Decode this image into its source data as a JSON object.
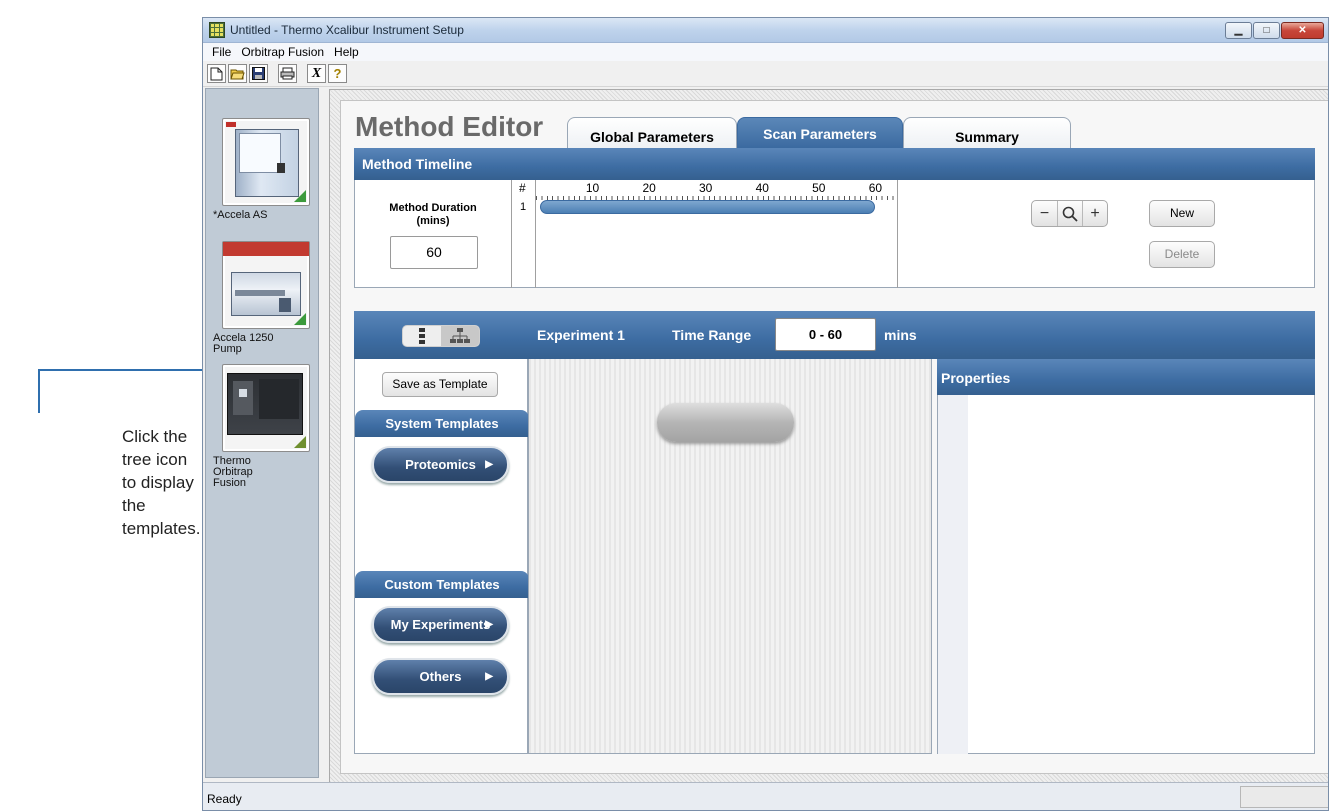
{
  "window": {
    "title": "Untitled - Thermo Xcalibur Instrument Setup"
  },
  "menu": [
    "File",
    "Orbitrap Fusion",
    "Help"
  ],
  "toolbar": {
    "new_icon": "new-document-icon",
    "open_icon": "open-folder-icon",
    "save_icon": "save-disk-icon",
    "print_icon": "printer-icon",
    "cut_icon": "x-icon",
    "help_icon": "help-question-icon"
  },
  "instruments": [
    {
      "label": "*Accela AS"
    },
    {
      "label": "Accela 1250 Pump"
    },
    {
      "label": "Thermo Orbitrap Fusion"
    }
  ],
  "editor": {
    "title": "Method Editor",
    "tabs": [
      "Global Parameters",
      "Scan Parameters",
      "Summary"
    ],
    "active_tab": "Scan Parameters"
  },
  "timeline": {
    "heading": "Method Timeline",
    "duration_label": "Method Duration (mins)",
    "duration_value": "60",
    "col_hash": "#",
    "row_number": "1",
    "ticks": [
      "10",
      "20",
      "30",
      "40",
      "50",
      "60"
    ],
    "experiment_span": [
      0,
      60
    ],
    "zoom_out": "−",
    "zoom_in": "+",
    "new_label": "New",
    "delete_label": "Delete"
  },
  "experiment": {
    "name": "Experiment 1",
    "time_range_label": "Time Range",
    "time_range_value": "0 - 60",
    "unit": "mins"
  },
  "templates": {
    "save_label": "Save as Template",
    "system_heading": "System Templates",
    "system_items": [
      "Proteomics"
    ],
    "custom_heading": "Custom Templates",
    "custom_items": [
      "My Experiments",
      "Others"
    ]
  },
  "properties": {
    "heading": "Properties"
  },
  "status": {
    "text": "Ready"
  },
  "callout": {
    "text": "Click the tree icon to display the templates."
  },
  "colors": {
    "accent": "#3d6ca2",
    "callout_line": "#2f6fae"
  }
}
